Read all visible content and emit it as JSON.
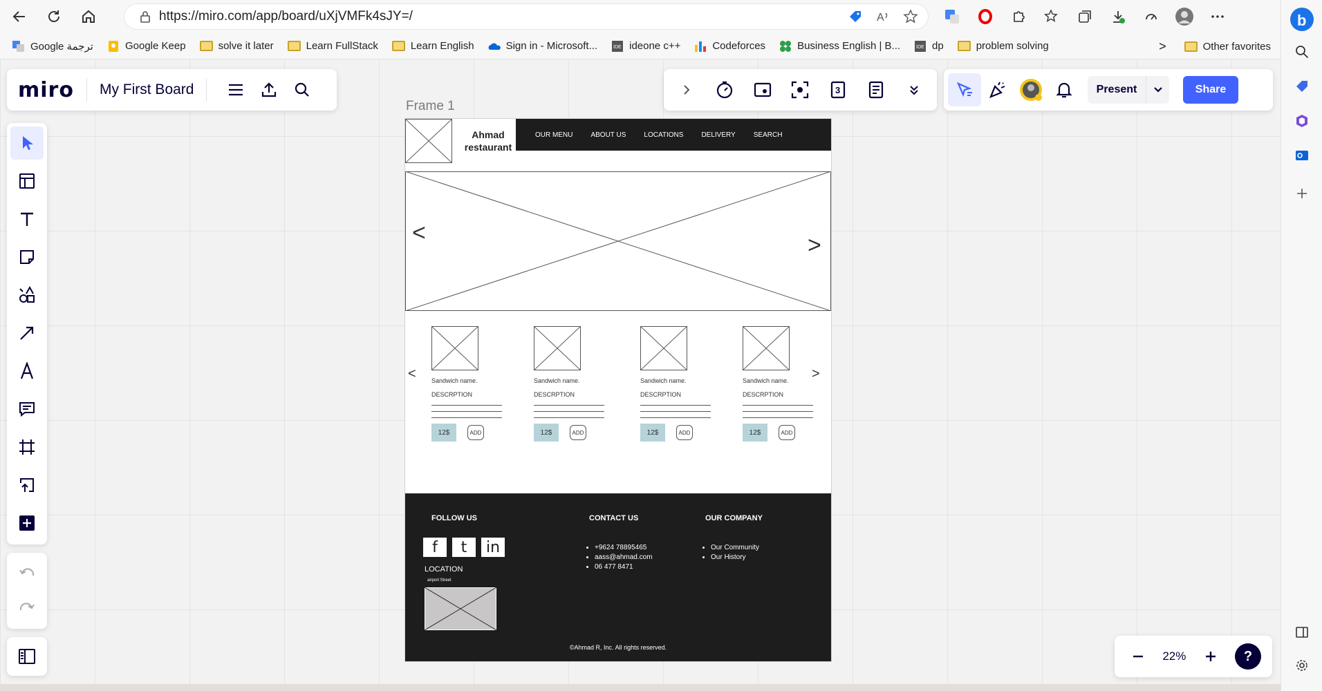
{
  "browser": {
    "url": "https://miro.com/app/board/uXjVMFk4sJY=/",
    "bookmarks": [
      {
        "label": "Google ترجمة",
        "icon": "google-translate-icon"
      },
      {
        "label": "Google Keep",
        "icon": "keep-icon"
      },
      {
        "label": "solve it later",
        "icon": "folder-icon"
      },
      {
        "label": "Learn FullStack",
        "icon": "folder-icon"
      },
      {
        "label": "Learn English",
        "icon": "folder-icon"
      },
      {
        "label": "Sign in - Microsoft...",
        "icon": "onedrive-icon"
      },
      {
        "label": "ideone c++",
        "icon": "ideone-icon"
      },
      {
        "label": "Codeforces",
        "icon": "codeforces-icon"
      },
      {
        "label": "Business English | B...",
        "icon": "clover-icon"
      },
      {
        "label": "dp",
        "icon": "ideone-icon"
      },
      {
        "label": "problem solving",
        "icon": "folder-icon"
      }
    ],
    "other_favorites": "Other favorites",
    "overflow_chevron": ">"
  },
  "miro": {
    "logo": "miro",
    "board_title": "My First Board",
    "present_label": "Present",
    "share_label": "Share",
    "zoom": "22%",
    "help": "?",
    "accent_color": "#4262ff"
  },
  "frame": {
    "label": "Frame 1",
    "restaurant_name": "Ahmad restaurant",
    "nav": [
      "OUR MENU",
      "ABOUT US",
      "LOCATIONS",
      "DELIVERY",
      "SEARCH"
    ],
    "hero_prev": "<",
    "hero_next": ">",
    "carousel_prev": "<",
    "carousel_next": ">",
    "cards": [
      {
        "name": "Sandwich name.",
        "description": "DESCRPTION",
        "price": "12$",
        "add": "ADD"
      },
      {
        "name": "Sandwich name.",
        "description": "DESCRPTION",
        "price": "12$",
        "add": "ADD"
      },
      {
        "name": "Sandwich name.",
        "description": "DESCRPTION",
        "price": "12$",
        "add": "ADD"
      },
      {
        "name": "Sandwich name.",
        "description": "DESCRPTION",
        "price": "12$",
        "add": "ADD"
      }
    ],
    "footer": {
      "follow_us": "FOLLOW US",
      "social": [
        "f",
        "t",
        "in"
      ],
      "location_title": "LOCATION",
      "location_street": "airport Street",
      "contact_title": "CONTACT US",
      "contacts": [
        "+9624 78895465",
        "aass@ahmad.com",
        "06 477 8471"
      ],
      "company_title": "OUR COMPANY",
      "company_links": [
        "Our Community",
        "Our History"
      ],
      "copyright": "©Ahmad R, Inc. All rights reserved."
    }
  }
}
